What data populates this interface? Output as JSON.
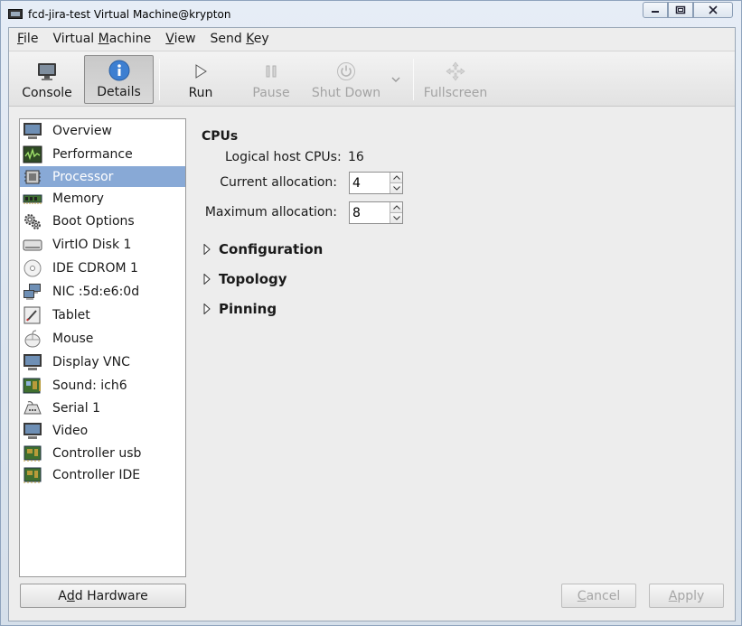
{
  "window": {
    "title": "fcd-jira-test Virtual Machine@krypton",
    "controls": {
      "minimize": "▭",
      "maximize": "▢",
      "close": "✕"
    }
  },
  "menu": [
    {
      "label": "File",
      "mnemonic": "F",
      "rest": "ile"
    },
    {
      "label": "Virtual Machine",
      "pre": "Virtual ",
      "mnemonic": "M",
      "rest": "achine"
    },
    {
      "label": "View",
      "mnemonic": "V",
      "rest": "iew"
    },
    {
      "label": "Send Key",
      "pre": "Send ",
      "mnemonic": "K",
      "rest": "ey"
    }
  ],
  "toolbar": {
    "console": "Console",
    "details": "Details",
    "run": "Run",
    "pause": "Pause",
    "shutdown": "Shut Down",
    "fullscreen": "Fullscreen"
  },
  "sidebar": {
    "items": [
      {
        "label": "Overview",
        "icon": "monitor-icon"
      },
      {
        "label": "Performance",
        "icon": "performance-icon"
      },
      {
        "label": "Processor",
        "icon": "cpu-icon",
        "selected": true
      },
      {
        "label": "Memory",
        "icon": "memory-icon"
      },
      {
        "label": "Boot Options",
        "icon": "gear-icon"
      },
      {
        "label": "VirtIO Disk 1",
        "icon": "disk-icon"
      },
      {
        "label": "IDE CDROM 1",
        "icon": "cdrom-icon"
      },
      {
        "label": "NIC :5d:e6:0d",
        "icon": "network-icon"
      },
      {
        "label": "Tablet",
        "icon": "tablet-icon"
      },
      {
        "label": "Mouse",
        "icon": "mouse-icon"
      },
      {
        "label": "Display VNC",
        "icon": "display-icon"
      },
      {
        "label": "Sound: ich6",
        "icon": "sound-icon"
      },
      {
        "label": "Serial 1",
        "icon": "serial-icon"
      },
      {
        "label": "Video",
        "icon": "video-icon"
      },
      {
        "label": "Controller usb",
        "icon": "controller-icon"
      },
      {
        "label": "Controller IDE",
        "icon": "controller-icon"
      }
    ],
    "add_hardware": {
      "pre": "A",
      "mnemonic": "d",
      "rest": "d Hardware"
    }
  },
  "details": {
    "cpus_title": "CPUs",
    "logical_label": "Logical host CPUs:",
    "logical_value": "16",
    "current_label": "Current allocation:",
    "current_value": "4",
    "maximum_label": "Maximum allocation:",
    "maximum_value": "8",
    "configuration": "Configuration",
    "topology": "Topology",
    "pinning": "Pinning"
  },
  "footer": {
    "cancel": {
      "mnemonic": "C",
      "rest": "ancel"
    },
    "apply": {
      "mnemonic": "A",
      "rest": "pply"
    }
  },
  "colors": {
    "selection": "#88a9d6",
    "info_blue": "#3d7fd1"
  }
}
